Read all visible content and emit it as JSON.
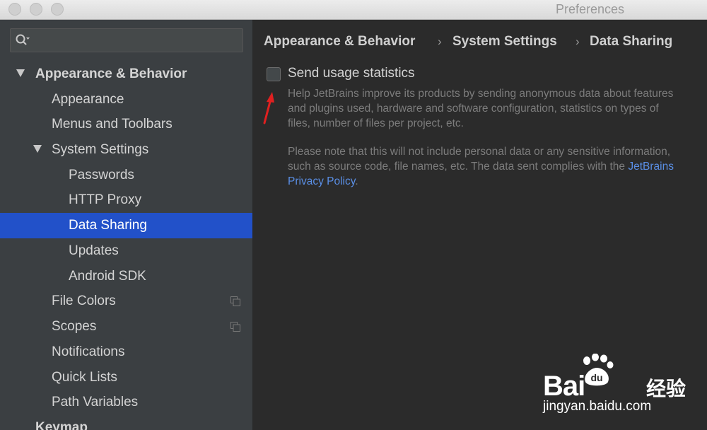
{
  "window": {
    "title": "Preferences"
  },
  "search": {
    "value": "",
    "placeholder": ""
  },
  "sidebar": {
    "items": [
      {
        "label": "Appearance & Behavior",
        "level": 0,
        "expanded": true,
        "bold": true
      },
      {
        "label": "Appearance",
        "level": 1
      },
      {
        "label": "Menus and Toolbars",
        "level": 1
      },
      {
        "label": "System Settings",
        "level": 1,
        "expanded": true
      },
      {
        "label": "Passwords",
        "level": 2
      },
      {
        "label": "HTTP Proxy",
        "level": 2
      },
      {
        "label": "Data Sharing",
        "level": 2,
        "selected": true
      },
      {
        "label": "Updates",
        "level": 2
      },
      {
        "label": "Android SDK",
        "level": 2
      },
      {
        "label": "File Colors",
        "level": 1,
        "icon": "copy-icon"
      },
      {
        "label": "Scopes",
        "level": 1,
        "icon": "copy-icon"
      },
      {
        "label": "Notifications",
        "level": 1
      },
      {
        "label": "Quick Lists",
        "level": 1
      },
      {
        "label": "Path Variables",
        "level": 1
      },
      {
        "label": "Keymap",
        "level": 0,
        "bold": true
      }
    ]
  },
  "breadcrumb": {
    "items": [
      "Appearance & Behavior",
      "System Settings",
      "Data Sharing"
    ],
    "separator": "›"
  },
  "main": {
    "checkbox_label": "Send usage statistics",
    "checkbox_checked": false,
    "help_paragraph_1": "Help JetBrains improve its products by sending anonymous data about features and plugins used, hardware and software configuration, statistics on types of files, number of files per project, etc.",
    "help_paragraph_2_prefix": "Please note that this will not include personal data or any sensitive information, such as source code, file names, etc. The data sent complies with the ",
    "help_link": "JetBrains Privacy Policy",
    "help_paragraph_2_suffix": "."
  },
  "watermark": {
    "wordmark": "Bai",
    "paw_text": "du",
    "suffix": "经验",
    "url": "jingyan.baidu.com"
  },
  "colors": {
    "selection": "#2251c9",
    "link": "#5a8fe6",
    "annotation_arrow": "#e02020"
  }
}
